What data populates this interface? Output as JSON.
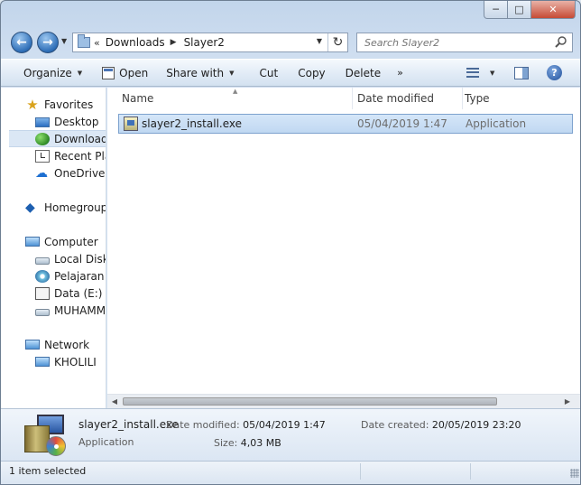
{
  "address": {
    "chevrons": "«",
    "crumbs": [
      "Downloads",
      "Slayer2"
    ]
  },
  "search": {
    "placeholder": "Search Slayer2"
  },
  "toolbar": {
    "organize": "Organize",
    "open": "Open",
    "share": "Share with",
    "cut": "Cut",
    "copy": "Copy",
    "delete": "Delete",
    "more": "»"
  },
  "nav": {
    "favorites": "Favorites",
    "desktop": "Desktop",
    "downloads": "Downloads",
    "recent": "Recent Places",
    "onedrive": "OneDrive",
    "homegroup": "Homegroup",
    "computer": "Computer",
    "local_disk": "Local Disk (C:)",
    "pelajaran": "Pelajaran (D:)",
    "data": "Data (E:)",
    "muhamma": "MUHAMMAD",
    "network": "Network",
    "kholili": "KHOLILI"
  },
  "columns": {
    "name": "Name",
    "date": "Date modified",
    "type": "Type"
  },
  "files": [
    {
      "name": "slayer2_install.exe",
      "date": "05/04/2019 1:47",
      "type": "Application"
    }
  ],
  "details": {
    "name": "slayer2_install.exe",
    "type": "Application",
    "modified_label": "Date modified:",
    "modified_value": "05/04/2019 1:47",
    "size_label": "Size:",
    "size_value": "4,03 MB",
    "created_label": "Date created:",
    "created_value": "20/05/2019 23:20"
  },
  "status": {
    "text": "1 item selected"
  },
  "colors": {
    "selection": "#c0d8f2",
    "accent": "#2f6fb8"
  }
}
